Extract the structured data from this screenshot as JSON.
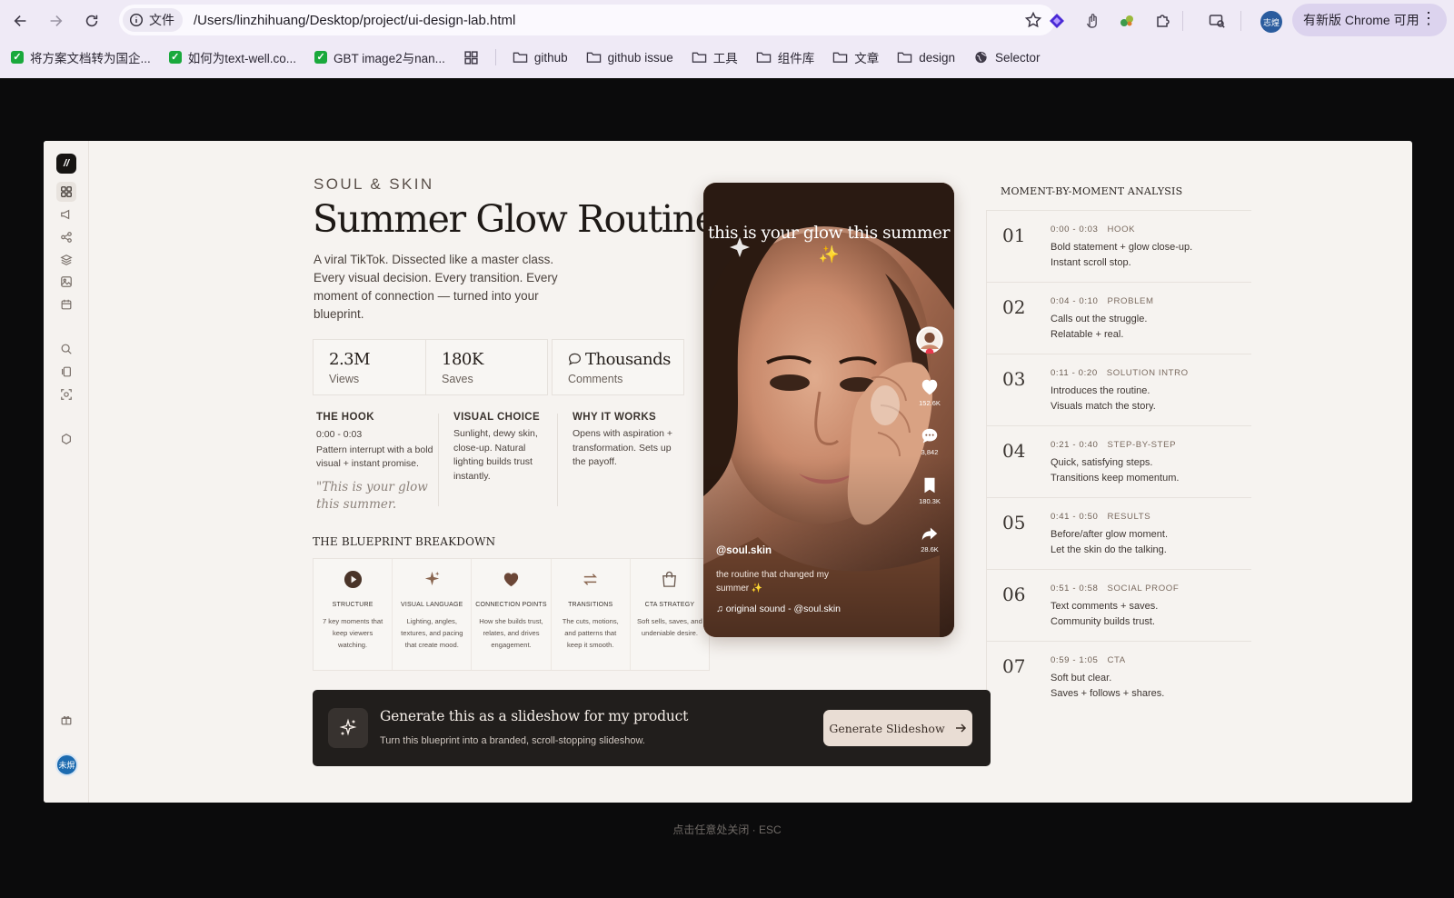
{
  "browser": {
    "info_label": "文件",
    "url": "/Users/linzhihuang/Desktop/project/ui-design-lab.html",
    "profile_initials": "志煌",
    "update_label": "有新版 Chrome 可用",
    "menu_glyph": "⋮",
    "bookmarks": [
      {
        "label": "将方案文档转为国企...",
        "kind": "check"
      },
      {
        "label": "如何为text-well.co...",
        "kind": "check"
      },
      {
        "label": "GBT image2与nan...",
        "kind": "check"
      },
      {
        "label": "github",
        "kind": "folder"
      },
      {
        "label": "github issue",
        "kind": "folder"
      },
      {
        "label": "工具",
        "kind": "folder"
      },
      {
        "label": "组件库",
        "kind": "folder"
      },
      {
        "label": "文章",
        "kind": "folder"
      },
      {
        "label": "design",
        "kind": "folder"
      },
      {
        "label": "Selector",
        "kind": "globe"
      }
    ]
  },
  "sidebar": {
    "logo": "//",
    "avatar_initials": "未焺"
  },
  "hero": {
    "brand": "SOUL & SKIN",
    "title": "Summer Glow Routine",
    "subtitle": "A viral TikTok. Dissected like a master class. Every visual decision. Every transition. Every moment of connection — turned into your blueprint."
  },
  "stats": [
    {
      "value": "2.3M",
      "label": "Views"
    },
    {
      "value": "180K",
      "label": "Saves"
    },
    {
      "value": "Thousands",
      "label": "Comments"
    }
  ],
  "analysis": {
    "hook": {
      "heading": "THE HOOK",
      "time": "0:00 - 0:03",
      "text": "Pattern interrupt with a bold visual + instant promise.",
      "quote": "\"This is your glow this summer."
    },
    "visual": {
      "heading": "VISUAL CHOICE",
      "text": "Sunlight, dewy skin, close-up. Natural lighting builds trust instantly."
    },
    "why": {
      "heading": "WHY IT WORKS",
      "text": "Opens with aspiration + transformation. Sets up the payoff."
    }
  },
  "blueprint": {
    "title": "THE BLUEPRINT BREAKDOWN",
    "items": [
      {
        "heading": "STRUCTURE",
        "text": "7 key moments that keep viewers watching.",
        "icon": "play-icon"
      },
      {
        "heading": "VISUAL LANGUAGE",
        "text": "Lighting, angles, textures, and pacing that create mood.",
        "icon": "sparkle-icon"
      },
      {
        "heading": "CONNECTION POINTS",
        "text": "How she builds trust, relates, and drives engagement.",
        "icon": "heart-icon"
      },
      {
        "heading": "TRANSITIONS",
        "text": "The cuts, motions, and patterns that keep it smooth.",
        "icon": "repeat-icon"
      },
      {
        "heading": "CTA STRATEGY",
        "text": "Soft sells, saves, and undeniable desire.",
        "icon": "bag-icon"
      }
    ]
  },
  "phone": {
    "caption": "this is your glow this summer ✨",
    "likes": "152.6K",
    "comments": "3,842",
    "saves": "180.3K",
    "shares": "28.6K",
    "handle": "@soul.skin",
    "description": "the routine that changed my summer ✨",
    "sound": "original sound - @soul.skin"
  },
  "moments": {
    "title": "MOMENT-BY-MOMENT ANALYSIS",
    "items": [
      {
        "num": "01",
        "time": "0:00 - 0:03",
        "label": "HOOK",
        "line1": "Bold statement + glow close-up.",
        "line2": "Instant scroll stop."
      },
      {
        "num": "02",
        "time": "0:04 - 0:10",
        "label": "PROBLEM",
        "line1": "Calls out the struggle.",
        "line2": "Relatable + real."
      },
      {
        "num": "03",
        "time": "0:11 - 0:20",
        "label": "SOLUTION INTRO",
        "line1": "Introduces the routine.",
        "line2": "Visuals match the story."
      },
      {
        "num": "04",
        "time": "0:21 - 0:40",
        "label": "STEP-BY-STEP",
        "line1": "Quick, satisfying steps.",
        "line2": "Transitions keep momentum."
      },
      {
        "num": "05",
        "time": "0:41 - 0:50",
        "label": "RESULTS",
        "line1": "Before/after glow moment.",
        "line2": "Let the skin do the talking."
      },
      {
        "num": "06",
        "time": "0:51 - 0:58",
        "label": "SOCIAL PROOF",
        "line1": "Text comments + saves.",
        "line2": "Community builds trust."
      },
      {
        "num": "07",
        "time": "0:59 - 1:05",
        "label": "CTA",
        "line1": "Soft but clear.",
        "line2": "Saves + follows + shares."
      }
    ]
  },
  "cta": {
    "heading": "Generate this as a slideshow for my product",
    "subtext": "Turn this blueprint into a branded, scroll-stopping slideshow.",
    "button": "Generate Slideshow"
  },
  "overlay_hint": "点击任意处关闭 · ESC",
  "colors": {
    "accent_dark": "#211e1c",
    "accent_warm": "#e9ddd4",
    "icon_brown": "#6b4e3f"
  }
}
